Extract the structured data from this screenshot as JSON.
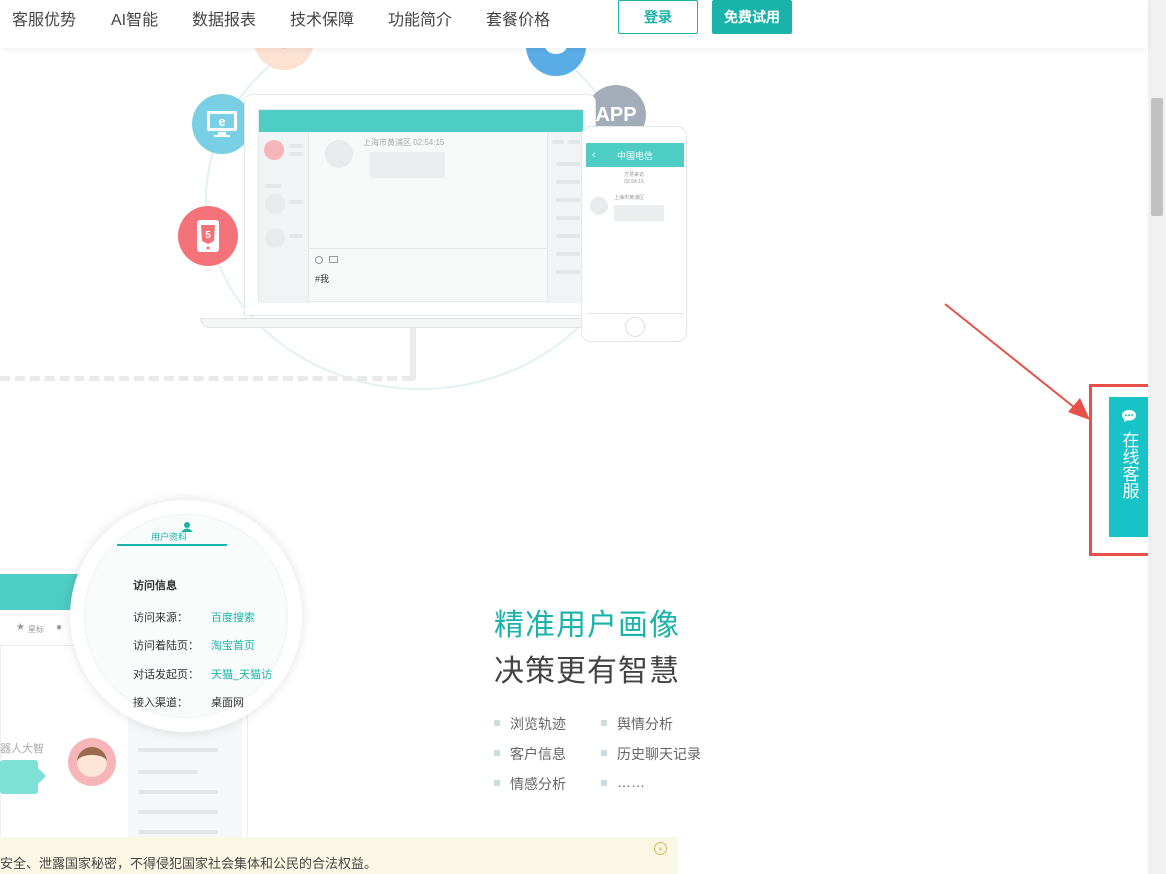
{
  "nav": {
    "items": [
      "客服优势",
      "AI智能",
      "数据报表",
      "技术保障",
      "功能简介",
      "套餐价格"
    ],
    "login_label": "登录",
    "trial_label": "免费试用"
  },
  "hero": {
    "app_badge": "APP",
    "chat_location": "上海市黄浦区 02:54:15",
    "input_text": "#我",
    "phone_title": "中国电信",
    "phone_line_1": "方慧来访",
    "phone_line_2": "02:54:15",
    "phone_line_3": "上海市黄浦区"
  },
  "profile": {
    "tab_label": "用户资料",
    "section_title": "访问信息",
    "rows": [
      {
        "label": "访问来源：",
        "value": "百度搜索"
      },
      {
        "label": "访问着陆页：",
        "value": "淘宝首页"
      },
      {
        "label": "对话发起页：",
        "value": "天猫_天猫访"
      },
      {
        "label": "接入渠道：",
        "value": "桌面网"
      }
    ],
    "toolbar_star": "星标",
    "robot_name": "器人大智"
  },
  "feature": {
    "title_line_1": "精准用户画像",
    "title_line_2": "决策更有智慧",
    "items": [
      "浏览轨迹",
      "舆情分析",
      "客户信息",
      "历史聊天记录",
      "情感分析",
      "……"
    ]
  },
  "notice": {
    "text": "安全、泄露国家秘密，不得侵犯国家社会集体和公民的合法权益。"
  },
  "widget": {
    "label": "在线客服",
    "icon": "chat-bubble-icon"
  },
  "colors": {
    "brand": "#19b3a9",
    "teal": "#4ecdc4",
    "widget": "#17c3c6",
    "highlight": "#e8514a"
  }
}
